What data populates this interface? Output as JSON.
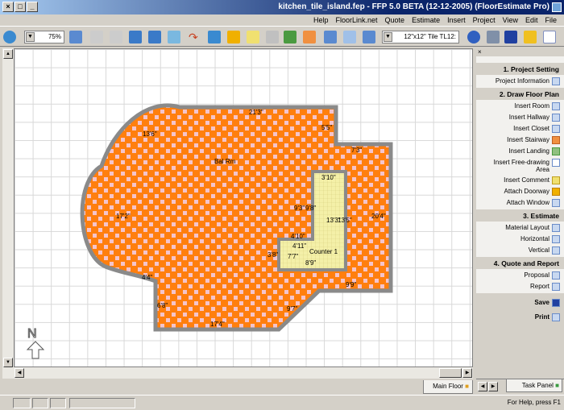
{
  "window": {
    "title": "kitchen_tile_island.fep - FFP 5.0 BETA (12-12-2005) (FloorEstimate Pro)"
  },
  "menu": [
    "File",
    "Edit",
    "View",
    "Project",
    "Insert",
    "Estimate",
    "Quote",
    "FloorLink.net",
    "Help"
  ],
  "toolbar": {
    "tile_select": "12\"x12\" Tile TL12:",
    "zoom": "75%"
  },
  "plan": {
    "room_label": "Bal Rm",
    "counter_label": "Counter 1",
    "dimensions": [
      "21'3\"",
      "5'5\"",
      "13'6\"",
      "7'3\"",
      "17'2\"",
      "20'4\"",
      "3'10\"",
      "9'3\"",
      "9'8\"",
      "13'3\"",
      "13'5\"",
      "4'10\"",
      "4'11\"",
      "3'8\"",
      "7'7\"",
      "8'9\"",
      "9'9\"",
      "4'4\"",
      "6'8\"",
      "9'7\"",
      "17'4\""
    ],
    "floor_colors": {
      "tile": "#ff7f0e",
      "grout": "#f4c4cc",
      "counter": "#f4f0a8"
    }
  },
  "panel": {
    "sections": [
      {
        "title": "1. Project Setting",
        "items": [
          "Project Information"
        ]
      },
      {
        "title": "2. Draw Floor Plan",
        "items": [
          "Insert Room",
          "Insert Hallway",
          "Insert Closet",
          "Insert Stairway",
          "Insert Landing",
          "Insert Free-drawing Area",
          "Insert Comment",
          "Attach Doorway",
          "Attach Window"
        ]
      },
      {
        "title": "3. Estimate",
        "items": [
          "Material Layout",
          "Horizontal",
          "Vertical"
        ]
      },
      {
        "title": "4. Quote and Report",
        "items": [
          "Proposal",
          "Report"
        ]
      }
    ],
    "save": "Save",
    "print": "Print",
    "tab": "Task Panel"
  },
  "floor_tab": "Main Floor",
  "status": {
    "help": "For Help, press F1"
  },
  "compass": "N"
}
